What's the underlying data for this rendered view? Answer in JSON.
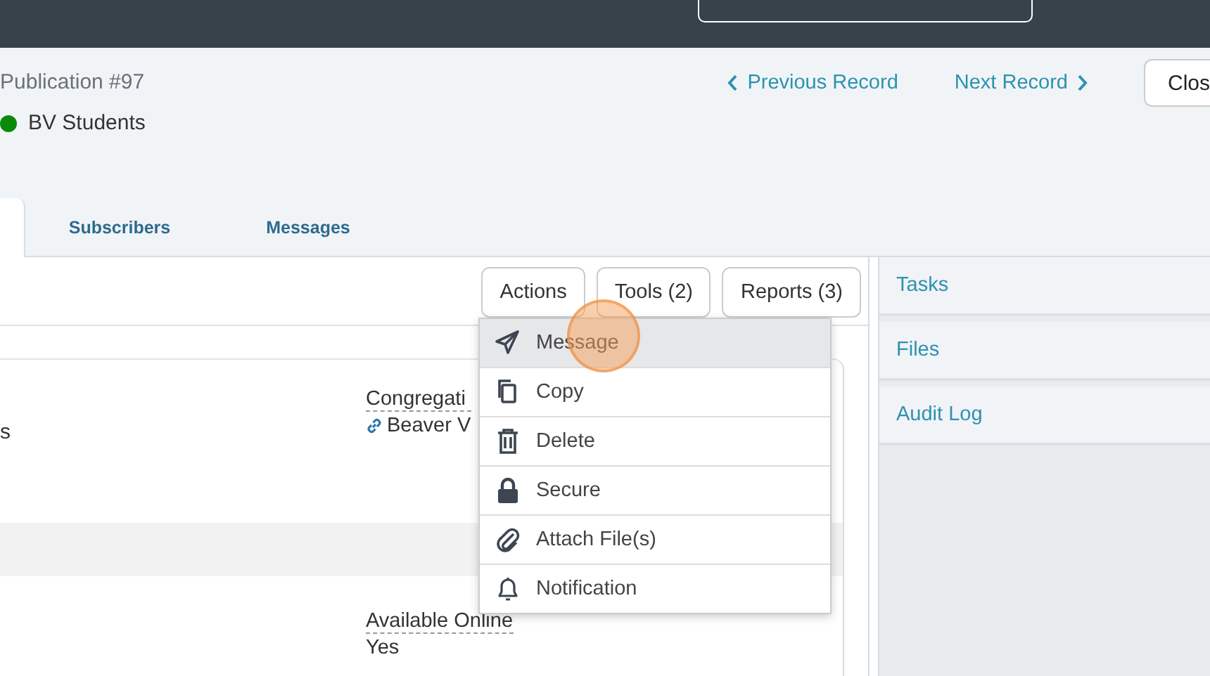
{
  "header": {
    "record_label": "Publication #97",
    "status": {
      "label": "BV Students",
      "color": "#0a8a0a"
    },
    "previous": "Previous Record",
    "next": "Next Record",
    "close": "Clos"
  },
  "tabs": [
    {
      "selected": true
    },
    {
      "label": "Subscribers",
      "selected": false
    },
    {
      "label": "Messages",
      "selected": false
    }
  ],
  "toolbar": [
    "Actions",
    "Tools (2)",
    "Reports (3)"
  ],
  "fields": [
    {
      "label": "Congregati",
      "value": "Beaver V",
      "link": true
    },
    {
      "label": "Available Online",
      "value": "Yes",
      "link": false
    }
  ],
  "left_fragment": "s",
  "actions_menu": [
    {
      "label": "Message",
      "highlighted": true
    },
    {
      "label": "Copy",
      "highlighted": false
    },
    {
      "label": "Delete",
      "highlighted": false
    },
    {
      "label": "Secure",
      "highlighted": false
    },
    {
      "label": "Attach File(s)",
      "highlighted": false
    },
    {
      "label": "Notification",
      "highlighted": false
    }
  ],
  "side_panels": [
    "Tasks",
    "Files",
    "Audit Log"
  ]
}
